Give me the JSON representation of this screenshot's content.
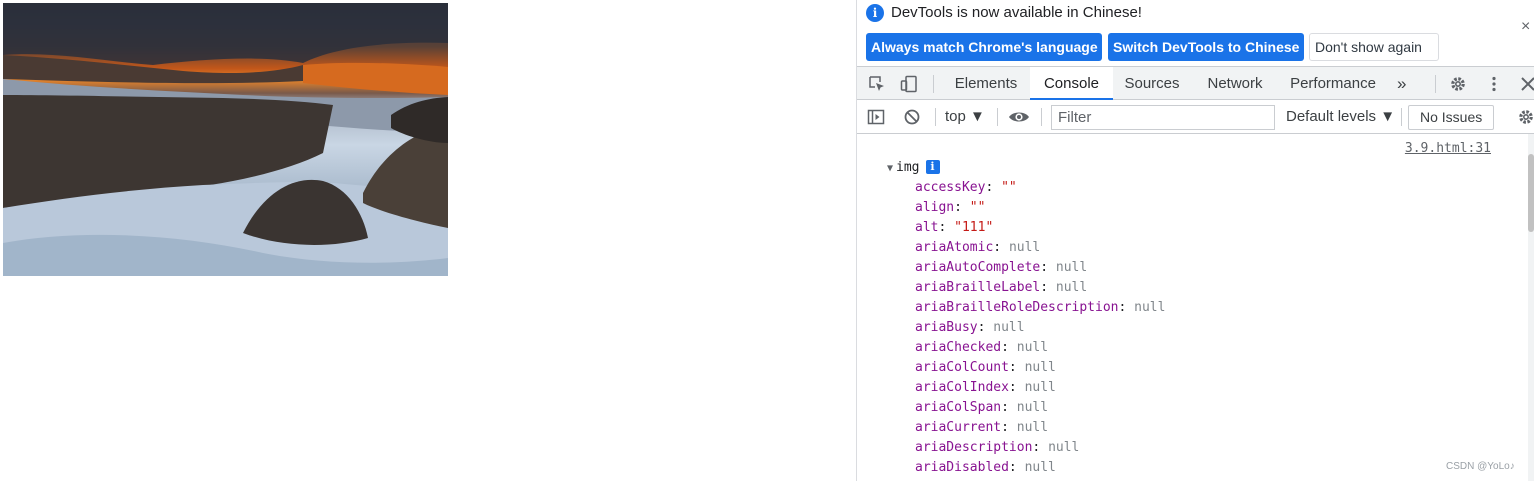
{
  "infobar": {
    "message": "DevTools is now available in Chinese!",
    "buttons": {
      "match_language": "Always match Chrome's language",
      "switch_chinese": "Switch DevTools to Chinese",
      "dont_show": "Don't show again"
    },
    "close_glyph": "×"
  },
  "tabs": [
    {
      "label": "Elements"
    },
    {
      "label": "Console"
    },
    {
      "label": "Sources"
    },
    {
      "label": "Network"
    },
    {
      "label": "Performance"
    }
  ],
  "tabs_overflow": "»",
  "console_toolbar": {
    "context": "top ▼",
    "filter_placeholder": "Filter",
    "levels": "Default levels ▼",
    "issues": "No Issues"
  },
  "console": {
    "source_link": "3.9.html:31",
    "object_label": "img",
    "info_badge": "i",
    "properties": [
      {
        "key": "accessKey",
        "value": "\"\"",
        "kind": "str"
      },
      {
        "key": "align",
        "value": "\"\"",
        "kind": "str"
      },
      {
        "key": "alt",
        "value": "\"111\"",
        "kind": "str"
      },
      {
        "key": "ariaAtomic",
        "value": "null",
        "kind": "null"
      },
      {
        "key": "ariaAutoComplete",
        "value": "null",
        "kind": "null"
      },
      {
        "key": "ariaBrailleLabel",
        "value": "null",
        "kind": "null"
      },
      {
        "key": "ariaBrailleRoleDescription",
        "value": "null",
        "kind": "null"
      },
      {
        "key": "ariaBusy",
        "value": "null",
        "kind": "null"
      },
      {
        "key": "ariaChecked",
        "value": "null",
        "kind": "null"
      },
      {
        "key": "ariaColCount",
        "value": "null",
        "kind": "null"
      },
      {
        "key": "ariaColIndex",
        "value": "null",
        "kind": "null"
      },
      {
        "key": "ariaColSpan",
        "value": "null",
        "kind": "null"
      },
      {
        "key": "ariaCurrent",
        "value": "null",
        "kind": "null"
      },
      {
        "key": "ariaDescription",
        "value": "null",
        "kind": "null"
      },
      {
        "key": "ariaDisabled",
        "value": "null",
        "kind": "null"
      }
    ]
  },
  "watermark": "CSDN @YoLo♪",
  "colors": {
    "accent": "#1a73e8",
    "property_key": "#881391",
    "string_value": "#c41a16",
    "null_value": "#80868b"
  }
}
